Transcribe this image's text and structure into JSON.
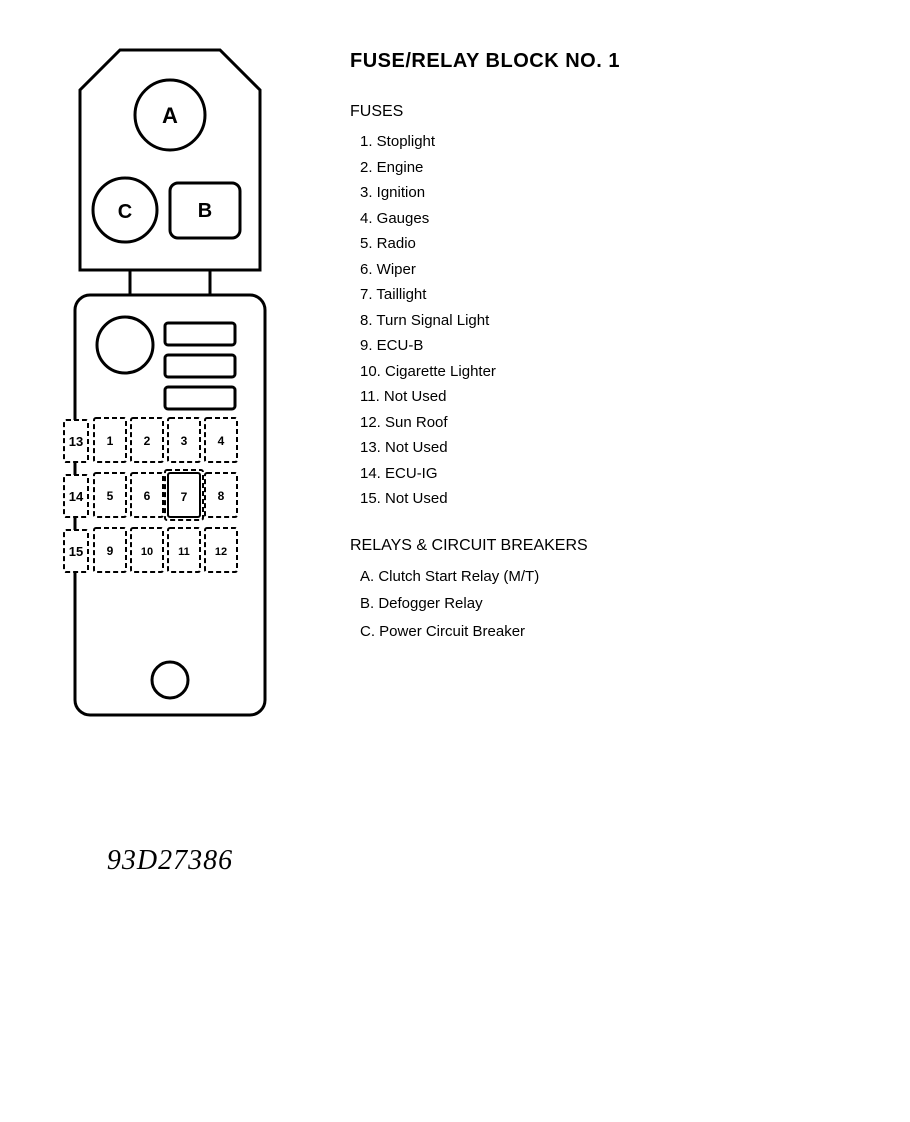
{
  "title": "FUSE/RELAY BLOCK NO. 1",
  "fuses_label": "FUSES",
  "fuses": [
    "1.  Stoplight",
    "2.  Engine",
    "3.  Ignition",
    "4.  Gauges",
    "5.  Radio",
    "6.  Wiper",
    "7.  Taillight",
    "8.  Turn Signal Light",
    "9.  ECU-B",
    "10. Cigarette Lighter",
    "11. Not Used",
    "12. Sun Roof",
    "13. Not Used",
    "14. ECU-IG",
    "15. Not Used"
  ],
  "relays_label": "RELAYS & CIRCUIT BREAKERS",
  "relays": [
    "A.  Clutch Start Relay (M/T)",
    "B.  Defogger Relay",
    "C.  Power Circuit Breaker"
  ],
  "diagram_caption": "93D27386",
  "relay_labels": {
    "a": "A",
    "b": "B",
    "c": "C"
  },
  "fuse_slots": {
    "row1": [
      "1",
      "2",
      "3",
      "4"
    ],
    "row2": [
      "5",
      "6",
      "7",
      "8"
    ],
    "row3": [
      "9",
      "10",
      "11",
      "12"
    ],
    "row_labels": [
      "13",
      "14",
      "15"
    ]
  }
}
